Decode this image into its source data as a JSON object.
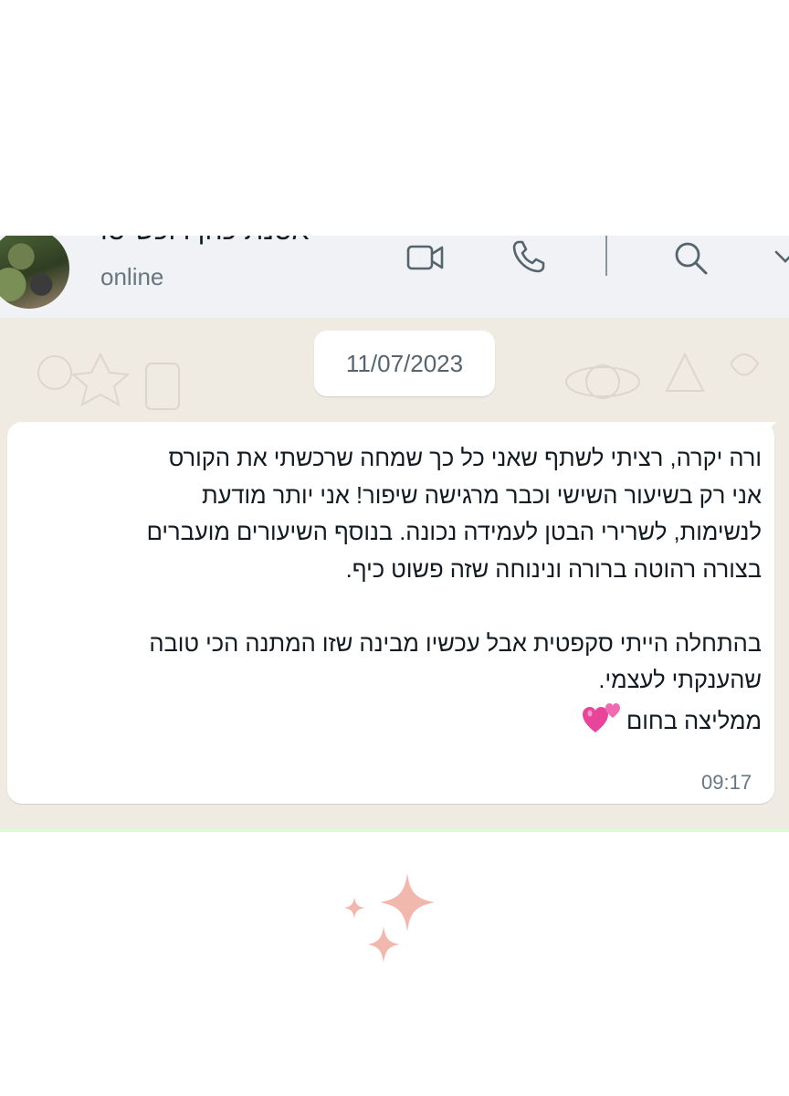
{
  "header": {
    "contact_name": "אסנת כהן רוכש·סו",
    "status": "online",
    "icons": [
      "contact-avatar",
      "video-call-icon",
      "voice-call-icon",
      "search-icon",
      "chevron-down-icon"
    ]
  },
  "chat": {
    "date_separator": "11/07/2023",
    "message": {
      "lines": [
        "ורה יקרה, רציתי לשתף שאני כל כך שמחה שרכשתי את הקורס",
        "אני רק בשיעור השישי וכבר מרגישה שיפור! אני יותר מודעת",
        "לנשימות, לשרירי הבטן לעמידה נכונה. בנוסף השיעורים מועברים",
        "בצורה רהוטה ברורה ונינוחה שזה פשוט כיף.",
        "",
        "בהתחלה הייתי סקפטית אבל עכשיו מבינה שזו המתנה הכי טובה",
        "שהענקתי לעצמי.",
        "ממליצה בחום"
      ],
      "emoji": "two-hearts-icon",
      "time": "09:17"
    }
  },
  "colors": {
    "header_bg": "#f0f2f5",
    "chat_bg": "#efeae2",
    "bubble_bg": "#ffffff",
    "icon_gray": "#54656f",
    "sparkle": "#f3b8ad",
    "heart": "#e8459a"
  },
  "decoration": {
    "icon": "sparkles-icon"
  }
}
